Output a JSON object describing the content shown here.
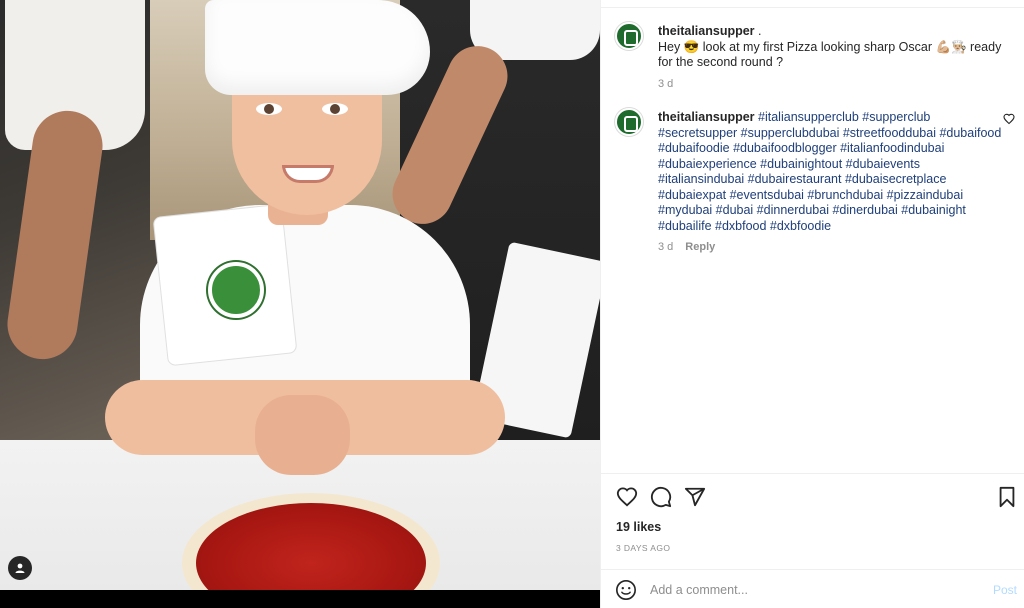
{
  "post": {
    "caption": {
      "username": "theitaliansupper",
      "username_suffix": " .",
      "text": "Hey 😎 look at my first Pizza looking sharp Oscar 💪🏼👨🏼‍🍳 ready for the second round ?",
      "time": "3 d"
    },
    "comment": {
      "username": "theitaliansupper",
      "hashtags": "#italiansupperclub #supperclub #secretsupper #supperclubdubai #streetfooddubai #dubaifood #dubaifoodie #dubaifoodblogger #italianfoodindubai #dubaiexperience #dubainightout #dubaievents #italiansindubai #dubairestaurant #dubaisecretplace #dubaiexpat #eventsdubai #brunchdubai #pizzaindubai #mydubai #dubai #dinnerdubai #dinerdubai #dubainight #dubailife #dxbfood #dxbfoodie",
      "time": "3 d",
      "reply_label": "Reply"
    },
    "likes": "19 likes",
    "date": "3 DAYS AGO",
    "add_comment": {
      "placeholder": "Add a comment...",
      "post_label": "Post"
    },
    "icons": {
      "like": "heart-icon",
      "comment": "comment-icon",
      "share": "share-icon",
      "save": "bookmark-icon",
      "emoji": "emoji-icon",
      "tagged_user": "user-icon"
    },
    "colors": {
      "text": "#262626",
      "secondary": "#8e8e8e",
      "hashtag": "#1f3f7a",
      "post_disabled": "#b3dbff"
    }
  }
}
